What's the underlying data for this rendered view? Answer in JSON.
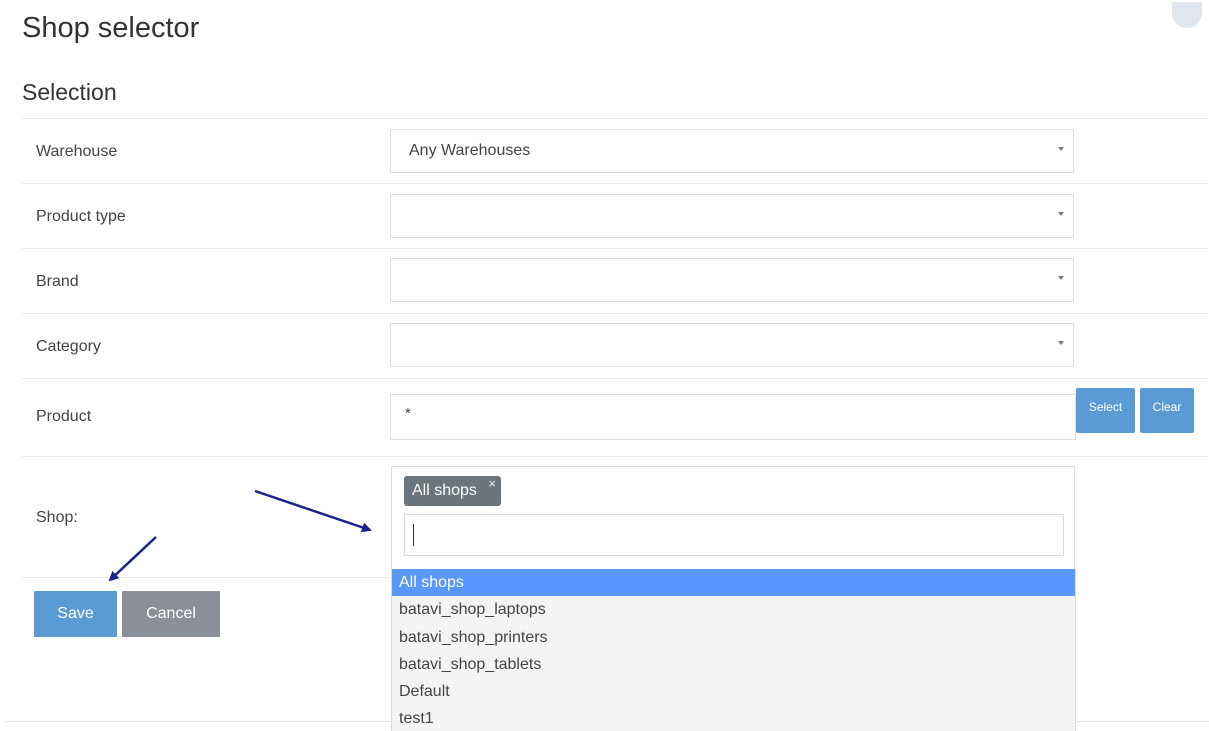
{
  "page": {
    "title": "Shop selector"
  },
  "section": {
    "title": "Selection"
  },
  "fields": {
    "warehouse": {
      "label": "Warehouse",
      "value": "Any Warehouses"
    },
    "product_type": {
      "label": "Product type",
      "value": ""
    },
    "brand": {
      "label": "Brand",
      "value": ""
    },
    "category": {
      "label": "Category",
      "value": ""
    },
    "product": {
      "label": "Product",
      "value": "*",
      "select_label": "Select",
      "clear_label": "Clear"
    },
    "shop": {
      "label": "Shop:",
      "selected_tag": "All shops",
      "tag_remove": "×",
      "search_value": "",
      "options": [
        "All shops",
        "batavi_shop_laptops",
        "batavi_shop_printers",
        "batavi_shop_tablets",
        "Default",
        "test1"
      ],
      "highlighted_option": "All shops"
    }
  },
  "actions": {
    "save_label": "Save",
    "cancel_label": "Cancel"
  },
  "colors": {
    "primary": "#5b9bd5",
    "secondary": "#8a8f99",
    "tag": "#6c757d",
    "highlight": "#5897fb",
    "annotation_arrow": "#1b1f8f"
  }
}
